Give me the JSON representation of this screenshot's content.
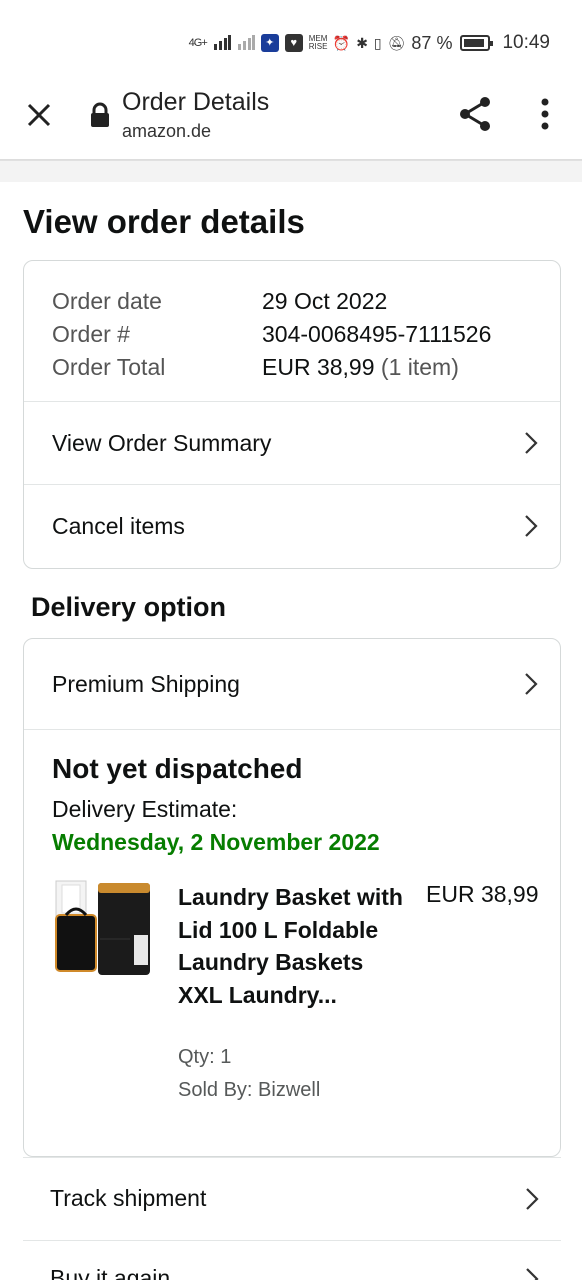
{
  "status_bar": {
    "network": "4G+",
    "mem_badge": "MEM RISE",
    "battery_percent": "87 %",
    "time": "10:49"
  },
  "app_bar": {
    "title": "Order Details",
    "url": "amazon.de"
  },
  "page": {
    "heading": "View order details"
  },
  "order_info": {
    "rows": [
      {
        "label": "Order date",
        "value": "29 Oct 2022",
        "extra": ""
      },
      {
        "label": "Order #",
        "value": "304-0068495-7111526",
        "extra": ""
      },
      {
        "label": "Order Total",
        "value": "EUR 38,99",
        "extra": "(1 item)"
      }
    ],
    "view_summary_label": "View Order Summary",
    "cancel_items_label": "Cancel items"
  },
  "delivery": {
    "heading": "Delivery option",
    "shipping_option": "Premium Shipping",
    "status": "Not yet dispatched",
    "estimate_label": "Delivery Estimate:",
    "estimate_date": "Wednesday, 2 November 2022",
    "accent_color": "#067d00"
  },
  "product": {
    "name": "Laundry Basket with Lid 100 L Foldable Laundry Baskets XXL Laundry...",
    "price": "EUR 38,99",
    "qty": "Qty: 1",
    "seller": "Sold By: Bizwell"
  },
  "actions": {
    "track_label": "Track shipment",
    "buy_again_label": "Buy it again"
  }
}
